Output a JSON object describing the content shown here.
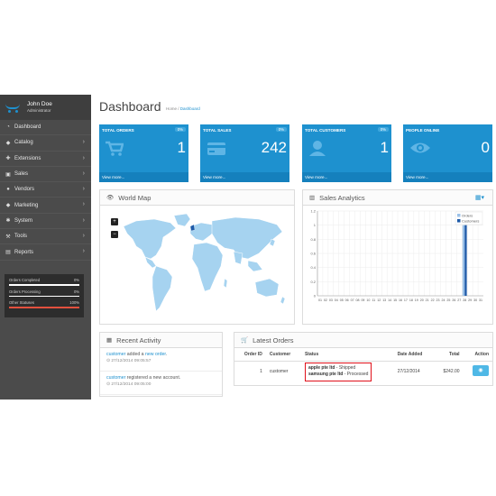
{
  "user": {
    "name": "John Doe",
    "role": "Administrator"
  },
  "menu": [
    {
      "label": "Dashboard",
      "icon": "dashboard-icon",
      "chevron": false
    },
    {
      "label": "Catalog",
      "icon": "tag-icon",
      "chevron": true
    },
    {
      "label": "Extensions",
      "icon": "puzzle-icon",
      "chevron": true
    },
    {
      "label": "Sales",
      "icon": "cart-icon",
      "chevron": true
    },
    {
      "label": "Vendors",
      "icon": "users-icon",
      "chevron": true
    },
    {
      "label": "Marketing",
      "icon": "share-icon",
      "chevron": true
    },
    {
      "label": "System",
      "icon": "gear-icon",
      "chevron": true
    },
    {
      "label": "Tools",
      "icon": "wrench-icon",
      "chevron": true
    },
    {
      "label": "Reports",
      "icon": "chart-icon",
      "chevron": true
    }
  ],
  "stats": [
    {
      "label": "Orders Completed",
      "value": "0%",
      "level": 0
    },
    {
      "label": "Orders Processing",
      "value": "0%",
      "level": 0
    },
    {
      "label": "Other Statuses",
      "value": "100%",
      "level": 100
    }
  ],
  "page": {
    "title": "Dashboard",
    "breadcrumb_home": "Home",
    "breadcrumb_current": "Dashboard"
  },
  "tiles": [
    {
      "title": "TOTAL ORDERS",
      "percent": "0%",
      "value": "1",
      "link": "View more...",
      "icon": "cart-icon"
    },
    {
      "title": "TOTAL SALES",
      "percent": "0%",
      "value": "242",
      "link": "View more...",
      "icon": "credit-card-icon"
    },
    {
      "title": "TOTAL CUSTOMERS",
      "percent": "0%",
      "value": "1",
      "link": "View more...",
      "icon": "user-icon"
    },
    {
      "title": "PEOPLE ONLINE",
      "percent": "",
      "value": "0",
      "link": "View more...",
      "icon": "eye-icon"
    }
  ],
  "map": {
    "title": "World Map",
    "zoom_in": "+",
    "zoom_out": "−"
  },
  "sales": {
    "title": "Sales Analytics"
  },
  "chart_data": {
    "type": "bar",
    "x": [
      "01",
      "02",
      "03",
      "04",
      "05",
      "06",
      "07",
      "08",
      "09",
      "10",
      "11",
      "12",
      "13",
      "14",
      "15",
      "16",
      "17",
      "18",
      "19",
      "20",
      "21",
      "22",
      "23",
      "24",
      "25",
      "26",
      "27",
      "28",
      "29",
      "30",
      "31"
    ],
    "series": [
      {
        "name": "Orders",
        "values": [
          0,
          0,
          0,
          0,
          0,
          0,
          0,
          0,
          0,
          0,
          0,
          0,
          0,
          0,
          0,
          0,
          0,
          0,
          0,
          0,
          0,
          0,
          0,
          0,
          0,
          0,
          0,
          1,
          0,
          0,
          0
        ]
      },
      {
        "name": "Customers",
        "values": [
          0,
          0,
          0,
          0,
          0,
          0,
          0,
          0,
          0,
          0,
          0,
          0,
          0,
          0,
          0,
          0,
          0,
          0,
          0,
          0,
          0,
          0,
          0,
          0,
          0,
          0,
          0,
          1,
          0,
          0,
          0
        ]
      }
    ],
    "yticks": [
      "0",
      "0.2",
      "0.4",
      "0.6",
      "0.8",
      "1",
      "1.2"
    ],
    "ylim": [
      0,
      1.2
    ],
    "legend_position": "top-right",
    "colors": [
      "#9cc2e8",
      "#1e5aa8"
    ],
    "grid": true
  },
  "activity": {
    "title": "Recent Activity",
    "items": [
      {
        "actor": "customer",
        "text": "added a",
        "link": "new order",
        "tail": ".",
        "time": "27/12/2014 09:05:57"
      },
      {
        "actor": "customer",
        "text": "registered a new account.",
        "link": "",
        "tail": "",
        "time": "27/12/2014 09:05:00"
      }
    ]
  },
  "orders": {
    "title": "Latest Orders",
    "headers": [
      "Order ID",
      "Customer",
      "Status",
      "Date Added",
      "Total",
      "Action"
    ],
    "rows": [
      {
        "id": "1",
        "customer": "customer",
        "status_1_vendor": "apple pte ltd",
        "status_1_text": " - Shipped",
        "status_2_vendor": "samsung pte ltd",
        "status_2_text": " - Processed",
        "date": "27/12/2014",
        "total": "$242.00"
      }
    ]
  }
}
